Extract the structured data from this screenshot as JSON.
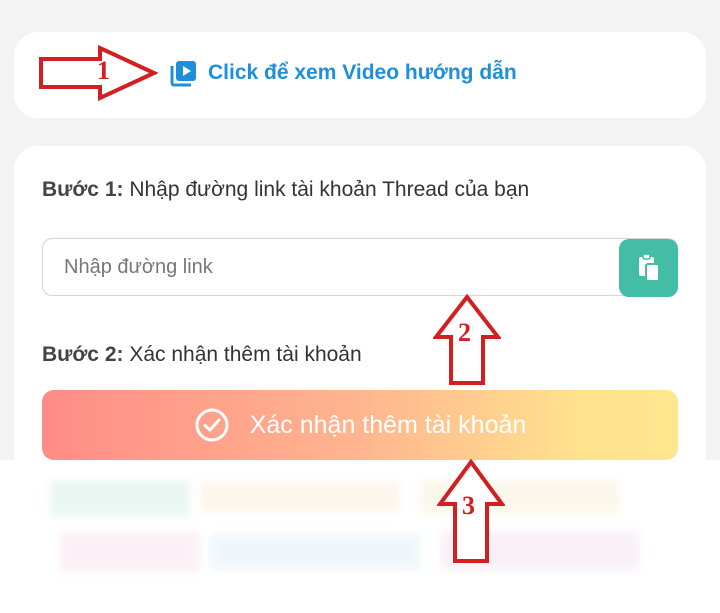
{
  "video_card": {
    "link_text": "Click để xem Video hướng dẫn"
  },
  "step1": {
    "prefix": "Bước 1:",
    "text": " Nhập đường link tài khoản Thread của bạn"
  },
  "link_input": {
    "placeholder": "Nhập đường link",
    "value": ""
  },
  "step2": {
    "prefix": "Bước 2:",
    "text": " Xác nhận thêm tài khoản"
  },
  "confirm_button": {
    "label": "Xác nhận thêm tài khoản"
  },
  "annotations": {
    "one": "1",
    "two": "2",
    "three": "3"
  },
  "colors": {
    "link_blue": "#1f8fdb",
    "paste_green": "#43bda5",
    "annotation_red": "#d31f1f"
  }
}
